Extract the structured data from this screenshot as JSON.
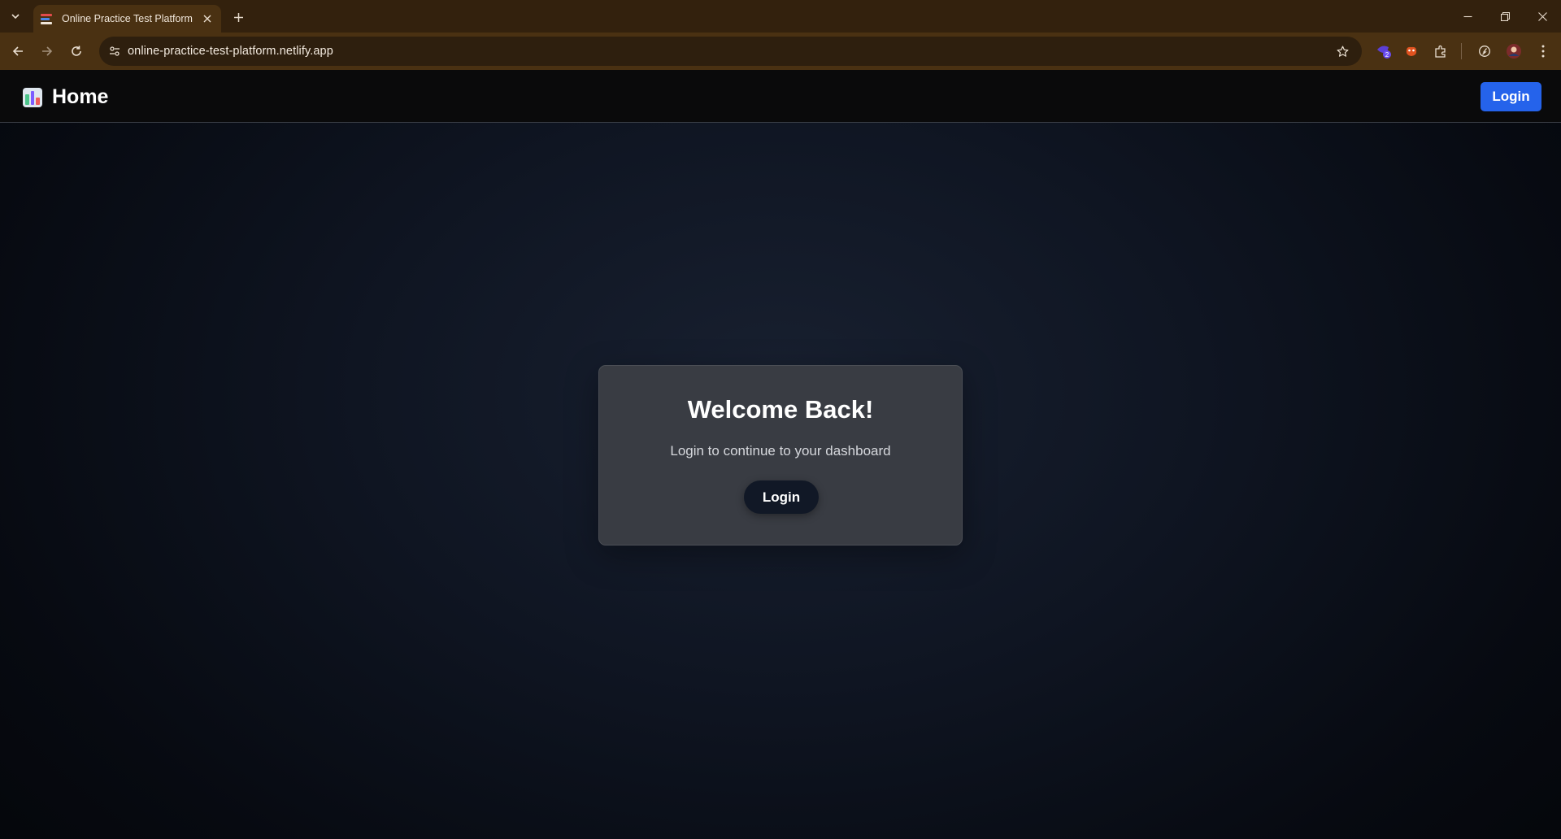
{
  "browser": {
    "tab_title": "Online Practice Test Platform",
    "url": "online-practice-test-platform.netlify.app",
    "ext_badge_count": "2"
  },
  "navbar": {
    "brand": "Home",
    "login_label": "Login",
    "login_color": "#2563eb"
  },
  "card": {
    "title": "Welcome Back!",
    "subtitle": "Login to continue to your dashboard",
    "login_label": "Login"
  },
  "icons": [
    "tab-list-icon",
    "app-favicon-icon",
    "close-icon",
    "plus-icon",
    "minimize-icon",
    "restore-icon",
    "back-icon",
    "forward-icon",
    "reload-icon",
    "site-info-icon",
    "star-icon",
    "extension-icon",
    "puzzle-icon",
    "profile-avatar-icon",
    "kebab-menu-icon",
    "chart-logo-icon"
  ]
}
